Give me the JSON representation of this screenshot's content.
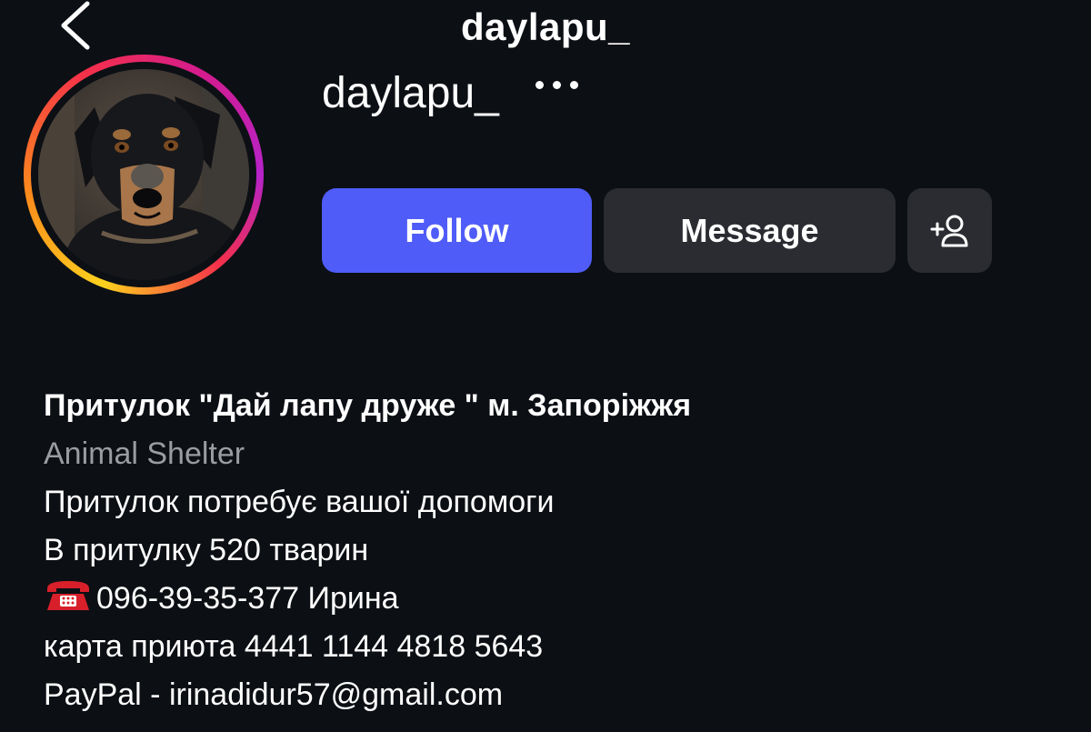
{
  "header": {
    "title": "daylapu_",
    "back_icon": "chevron-left-icon"
  },
  "profile": {
    "username": "daylapu_",
    "more_icon": "more-horizontal-icon",
    "ring_colors": [
      "#fdd11e",
      "#fb8b1c",
      "#f5304a",
      "#d41c8e",
      "#b623c9"
    ]
  },
  "actions": {
    "follow_label": "Follow",
    "message_label": "Message",
    "add_friend_icon": "add-person-icon",
    "follow_color": "#4f5cf8",
    "secondary_color": "#2a2c31"
  },
  "bio": {
    "name": "Притулок \"Дай лапу друже \" м. Запоріжжя",
    "category": "Animal Shelter",
    "lines": [
      "Притулок потребує вашої допомоги",
      "В притулку 520 тварин"
    ],
    "phone_icon": "telephone-icon",
    "phone": "096-39-35-377 Ирина",
    "card": "карта приюта 4441 1144 4818 5643",
    "paypal": "PayPal - irinadidur57@gmail.com"
  }
}
